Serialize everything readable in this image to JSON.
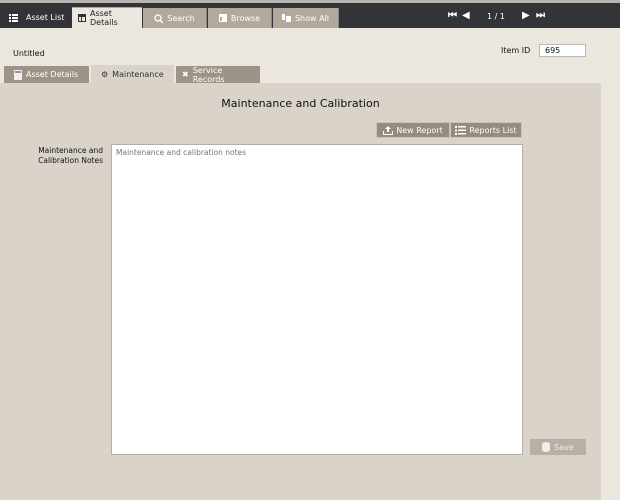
{
  "top_tabs": [
    {
      "label": "Asset List",
      "icon": "list-icon"
    },
    {
      "label": "Asset Details",
      "icon": "table-icon"
    },
    {
      "label": "Search",
      "icon": "search-icon"
    },
    {
      "label": "Browse",
      "icon": "browse-icon"
    },
    {
      "label": "Show All",
      "icon": "show-all-icon"
    }
  ],
  "nav": {
    "record": "1 / 1"
  },
  "header": {
    "title": "Untitled",
    "item_id_label": "Item ID",
    "item_id": "695"
  },
  "sub_tabs": [
    {
      "label": "Asset Details"
    },
    {
      "label": "Maintenance"
    },
    {
      "label": "Service Records"
    }
  ],
  "panel": {
    "title": "Maintenance and Calibration",
    "new_report": "New Report",
    "reports_list": "Reports List",
    "notes_label": "Maintenance and Calibration Notes",
    "notes_placeholder": "Maintenance and calibration notes",
    "save": "Save"
  }
}
